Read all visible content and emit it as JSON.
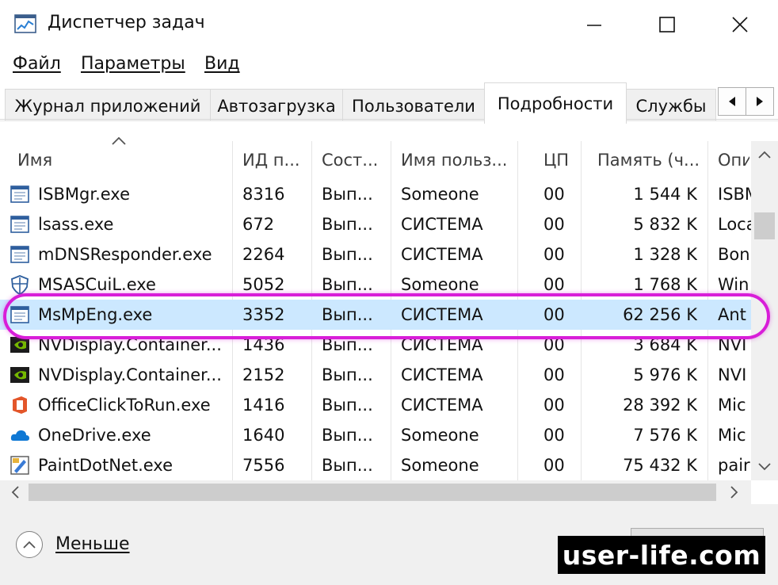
{
  "window": {
    "title": "Диспетчер задач"
  },
  "menu": [
    "Файл",
    "Параметры",
    "Вид"
  ],
  "tabs": [
    "Журнал приложений",
    "Автозагрузка",
    "Пользователи",
    "Подробности",
    "Службы"
  ],
  "active_tab": "Подробности",
  "table": {
    "columns": [
      "Имя",
      "ИД п...",
      "Сост...",
      "Имя польз...",
      "ЦП",
      "Память (ч...",
      "Опи"
    ],
    "rows": [
      {
        "name": "ISBMgr.exe",
        "pid": "8316",
        "status": "Вып...",
        "user": "Someone",
        "cpu": "00",
        "mem": "1 544 K",
        "desc": "ISBM",
        "icon": "app-window-icon"
      },
      {
        "name": "lsass.exe",
        "pid": "672",
        "status": "Вып...",
        "user": "СИСТЕМА",
        "cpu": "00",
        "mem": "5 832 K",
        "desc": "Loca",
        "icon": "app-window-icon"
      },
      {
        "name": "mDNSResponder.exe",
        "pid": "2264",
        "status": "Вып...",
        "user": "СИСТЕМА",
        "cpu": "00",
        "mem": "1 328 K",
        "desc": "Bon",
        "icon": "app-window-icon"
      },
      {
        "name": "MSASCuiL.exe",
        "pid": "5052",
        "status": "Вып...",
        "user": "Someone",
        "cpu": "00",
        "mem": "1 768 K",
        "desc": "Win",
        "icon": "windows-defender-icon"
      },
      {
        "name": "MsMpEng.exe",
        "pid": "3352",
        "status": "Вып...",
        "user": "СИСТЕМА",
        "cpu": "00",
        "mem": "62 256 K",
        "desc": "Ant",
        "icon": "app-window-icon"
      },
      {
        "name": "NVDisplay.Container...",
        "pid": "1436",
        "status": "Вып...",
        "user": "СИСТЕМА",
        "cpu": "00",
        "mem": "3 684 K",
        "desc": "NVI",
        "icon": "nvidia-icon"
      },
      {
        "name": "NVDisplay.Container...",
        "pid": "2152",
        "status": "Вып...",
        "user": "СИСТЕМА",
        "cpu": "00",
        "mem": "5 976 K",
        "desc": "NVI",
        "icon": "nvidia-icon"
      },
      {
        "name": "OfficeClickToRun.exe",
        "pid": "1416",
        "status": "Вып...",
        "user": "СИСТЕМА",
        "cpu": "00",
        "mem": "28 392 K",
        "desc": "Mic",
        "icon": "office-icon"
      },
      {
        "name": "OneDrive.exe",
        "pid": "1640",
        "status": "Вып...",
        "user": "Someone",
        "cpu": "00",
        "mem": "7 576 K",
        "desc": "Mic",
        "icon": "onedrive-icon"
      },
      {
        "name": "PaintDotNet.exe",
        "pid": "7556",
        "status": "Вып...",
        "user": "Someone",
        "cpu": "00",
        "mem": "75 432 K",
        "desc": "pair",
        "icon": "paintdotnet-icon"
      }
    ],
    "selected_row": "MsMpEng.exe"
  },
  "footer": {
    "less_label": "Меньше"
  },
  "watermark": "user-life.com",
  "colors": {
    "selection": "#cce8ff",
    "highlight": "#d81ed8"
  }
}
